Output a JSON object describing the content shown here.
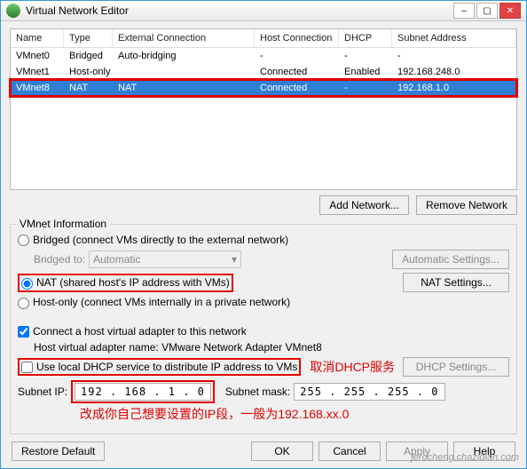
{
  "window": {
    "title": "Virtual Network Editor"
  },
  "grid": {
    "headers": {
      "name": "Name",
      "type": "Type",
      "ext": "External Connection",
      "host": "Host Connection",
      "dhcp": "DHCP",
      "subnet": "Subnet Address"
    },
    "rows": [
      {
        "name": "VMnet0",
        "type": "Bridged",
        "ext": "Auto-bridging",
        "host": "-",
        "dhcp": "-",
        "subnet": "-"
      },
      {
        "name": "VMnet1",
        "type": "Host-only",
        "ext": "",
        "host": "Connected",
        "dhcp": "Enabled",
        "subnet": "192.168.248.0"
      },
      {
        "name": "VMnet8",
        "type": "NAT",
        "ext": "NAT",
        "host": "Connected",
        "dhcp": "-",
        "subnet": "192.168.1.0"
      }
    ]
  },
  "buttons": {
    "add": "Add Network...",
    "remove": "Remove Network",
    "auto": "Automatic Settings...",
    "nat": "NAT Settings...",
    "dhcp": "DHCP Settings...",
    "restore": "Restore Default",
    "ok": "OK",
    "cancel": "Cancel",
    "apply": "Apply",
    "help": "Help"
  },
  "info": {
    "title": "VMnet Information",
    "bridged": "Bridged (connect VMs directly to the external network)",
    "bridged_to": "Bridged to:",
    "bridged_val": "Automatic",
    "nat": "NAT (shared host's IP address with VMs)",
    "hostonly": "Host-only (connect VMs internally in a private network)",
    "hostadapter": "Connect a host virtual adapter to this network",
    "hostadapter_name": "Host virtual adapter name: VMware Network Adapter VMnet8",
    "dhcp": "Use local DHCP service to distribute IP address to VMs",
    "subnet_ip_lbl": "Subnet IP:",
    "subnet_ip": "192 . 168 .  1  .  0",
    "subnet_mask_lbl": "Subnet mask:",
    "subnet_mask": "255 . 255 . 255 .  0"
  },
  "annotations": {
    "dhcp": "取消DHCP服务",
    "ip": "改成你自己想要设置的IP段，一般为192.168.xx.0"
  },
  "watermark": "jerocheng.chazidian.com"
}
